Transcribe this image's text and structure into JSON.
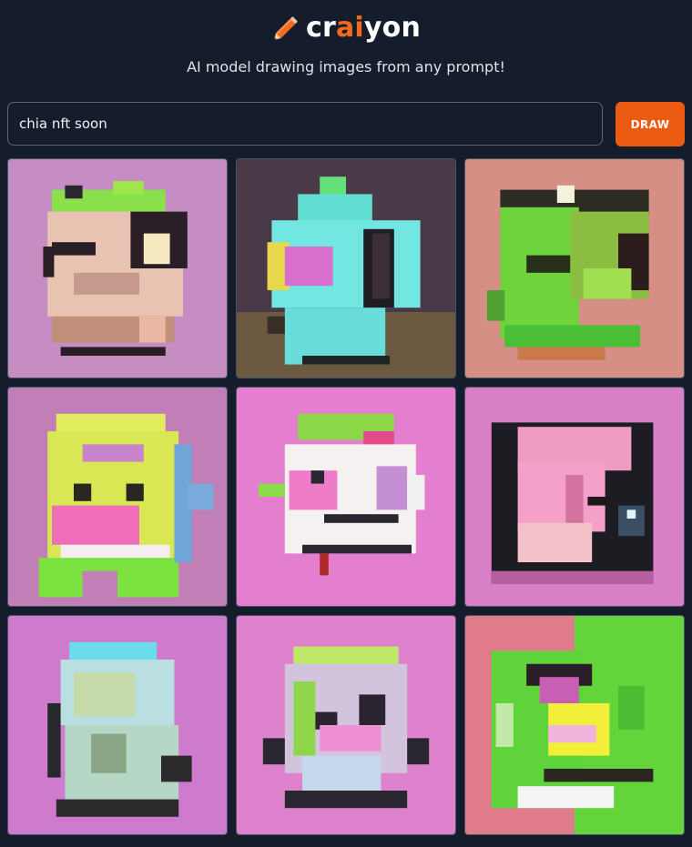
{
  "brand": {
    "prefix": "cr",
    "highlight": "ai",
    "suffix": "yon",
    "icon": "pencil-icon",
    "accent": "#eb5b12",
    "highlight_color": "#f26a1e"
  },
  "tagline": "AI model drawing images from any prompt!",
  "search": {
    "value": "chia nft soon",
    "placeholder": ""
  },
  "draw_button": {
    "label": "DRAW"
  },
  "results": [
    {
      "name": "result-image-1",
      "bg": "#c58dc1"
    },
    {
      "name": "result-image-2",
      "bg": "#4a3a48"
    },
    {
      "name": "result-image-3",
      "bg": "#d68f84"
    },
    {
      "name": "result-image-4",
      "bg": "#c27eb6"
    },
    {
      "name": "result-image-5",
      "bg": "#e47fcf"
    },
    {
      "name": "result-image-6",
      "bg": "#d87fc8"
    },
    {
      "name": "result-image-7",
      "bg": "#cf7bcd"
    },
    {
      "name": "result-image-8",
      "bg": "#de82cd"
    },
    {
      "name": "result-image-9",
      "bg": "#e07c8a"
    }
  ]
}
